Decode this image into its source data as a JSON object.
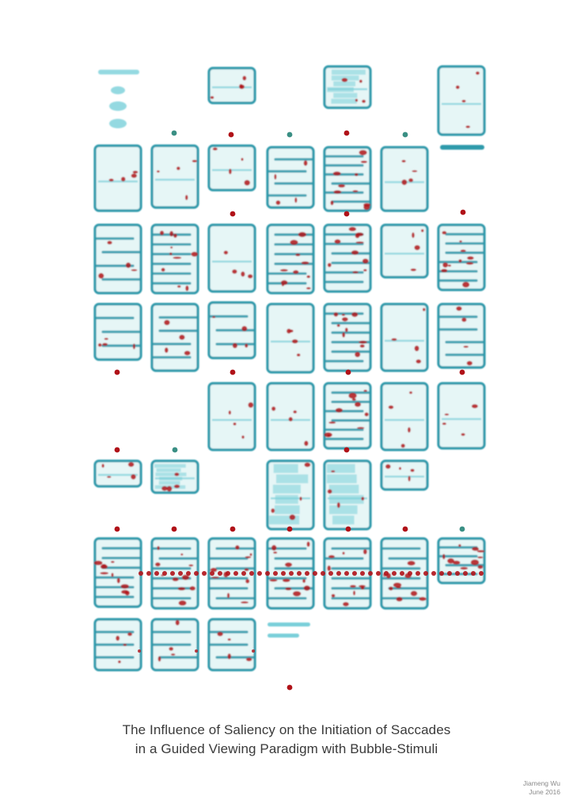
{
  "title": {
    "line1": "The Influence of Saliency on the Initiation of Saccades",
    "line2": "in a Guided Viewing Paradigm with Bubble-Stimuli"
  },
  "credit": {
    "author": "Jiameng Wu",
    "date": "June 2016"
  },
  "colors": {
    "fill": "#e6f6f6",
    "outline": "#2d9aab",
    "light": "#79cfd9",
    "hot": "#b01218",
    "dot_teal": "#3a8f84"
  }
}
